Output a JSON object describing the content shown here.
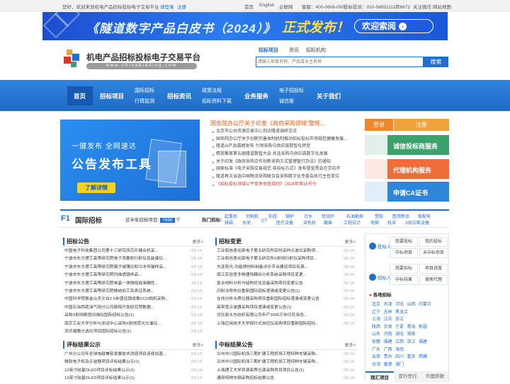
{
  "topbar": {
    "welcome": "您好，欢迎来到机电产品招标投标电子交易平台",
    "login": "请登录",
    "register": "注册",
    "links": [
      "首页",
      "English",
      "必联网"
    ],
    "phone_label": "客服：400-0606-000",
    "phone2_label": "投标投诉：010-58851111转6672",
    "wechat": "关注微信",
    "sitemap": "网站地图"
  },
  "banner": {
    "title": "《隧道数字产品白皮书（2024）》",
    "headline": "正式发布！",
    "button": "欢迎索阅"
  },
  "logo": {
    "name": "机电产品招标投标电子交易平台",
    "url": "www.chinabidding.com"
  },
  "search": {
    "tabs": [
      "招标项目",
      "资讯",
      "招标机构"
    ],
    "placeholder": "请输入项目名称、产品或业主名称",
    "button": "搜索"
  },
  "nav": {
    "home": "首页",
    "projects": "招标项目",
    "intl_bid": "国际招标",
    "credit": "行情监测",
    "news": "招标资讯",
    "policy": "政策法规",
    "docs": "招标资料下载",
    "service": "业务服务",
    "ebid": "电子招投标",
    "honest": "诚信版",
    "about": "关于我们"
  },
  "ad": {
    "line1": "一键发布   全网速达",
    "line2": "公告发布工具",
    "button": "了解详情"
  },
  "news": {
    "headline": "国务院办公厅关于印发《政府采购领域\"整顿...",
    "items": [
      "北京市公共资源交易中心到访隆道调研交流",
      "国务院办公厅关于创新完善体制机制推动招标投标市场规范健康发展...",
      "隆道AI产品震撼发布 引领采购与供应链数智化转型",
      "精英聚首第五届隆道数智大会 共话采购与供应链数字化发展",
      "关于印发《政府采购合作创新采购方式管理暂行办法》的通知",
      "国家标准《电子采购交易规范 非招标方式》发布暨宣贯会在京召开",
      "隆道再次当选中国物流采购联合会采购数字化专委会执行主任单位"
    ],
    "red_item": "《招标投标领域公平竞争审查规则》 2024年第16号令"
  },
  "auth": {
    "login": "登录",
    "register": "注册"
  },
  "services": [
    {
      "label": "诚信投标商服务",
      "color": "#3aa26a"
    },
    {
      "label": "代理机构服务",
      "color": "#ef6d3a"
    },
    {
      "label": "申请CA证书",
      "color": "#2f85da"
    }
  ],
  "f1": {
    "no": "F1",
    "title": "国际招标",
    "count_label": "近半年招标项目:",
    "count": "7696",
    "count_unit": "个",
    "hot_label": "热门招标:",
    "tags_row1": [
      "起重机",
      "切割机",
      "彩超",
      "锅炉",
      "污水",
      "焚烧炉",
      "石油勘探",
      "塑胶",
      "医用新品",
      "锻配电"
    ],
    "tags_row2": [
      "核磁",
      "水泥",
      "CT",
      "医疗设备",
      "染色机",
      "腹珠",
      "工程设计",
      "电梯",
      "机床",
      "X线诊断设备"
    ]
  },
  "bid_notice": {
    "title": "招标公告",
    "more": "更多>",
    "rows": [
      [
        "中国电子科技集团公司第十三研究所芯片键合机采...",
        "09-14"
      ],
      [
        "宁波市东方理工高等研究院电子背散射衍射仪及能谱仪...",
        "09-14"
      ],
      [
        "宁波市东方理工高等研究院离子减薄仪和冷冻传输样品...",
        "09-14"
      ],
      [
        "宁波市东方理工高等研究院扫描透镜样品...",
        "09-14"
      ],
      [
        "宁波市东方理工高等研究院单晶一体微组成准确性...",
        "09-14"
      ],
      [
        "宁波市东方理工高等研究院微纳加工及表征系统...",
        "09-14"
      ],
      [
        "中国科学院紫金山天文台2.5米望远镜成像CCD相机采购...",
        "09-14"
      ],
      [
        "中国石油西南油气田分公司勘探开发研究院数据...",
        "09-14"
      ],
      [
        "采购X射线断层扫描仪国际招标公告(1)",
        "09-14"
      ],
      [
        "南京工业大学分析与测试中心采购X射线荧光光谱仪...",
        "09-14"
      ],
      [
        "流式细胞分选仪项目国际招标公告(1)",
        "09-14"
      ]
    ]
  },
  "bid_change": {
    "title": "招标变更",
    "more": "更多>",
    "rows": [
      [
        "工业和信息化部电子第五研究所实时采样示波仪采购项...",
        "09-14"
      ],
      [
        "工业和信息化部电子第五研究所X射线衍射仪采购项目...",
        "09-14"
      ],
      [
        "大连阳光-功能燃材料制备评价平台建设项目有源...",
        "09-14"
      ],
      [
        "南江实验室多物理场耦合分析系统采购项目变更...",
        "09-14"
      ],
      [
        "复合材料分析与结构优化设备采购项目变更公告",
        "09-14"
      ],
      [
        "闪射法导热仪重新国际招标澄清或变更公告(1)",
        "09-14"
      ],
      [
        "在线分析水质仪器采购项目重新国际招标澄清或变更公告",
        "09-14"
      ],
      [
        "高带宽示波器采购项目澄清或变更公告(1)",
        "09-14"
      ],
      [
        "河北新太东纺织有限公司年产3000万米印花染色...",
        "09-14"
      ],
      [
        "上海应用技术大学探针式自控仪采购项目重新国际招标...",
        "09-14"
      ]
    ]
  },
  "result_notice": {
    "title": "评标结果公示",
    "more": "更多>",
    "rows": [
      [
        "广州分公司年全球电磁兼容发展技术改造项目连续加盖...",
        "09-14"
      ],
      [
        "微软电子机及示波器项目评标结果公示(1)",
        "09-14"
      ],
      [
        "12英寸硅基OLED项目评标结果公示(1)",
        "09-14"
      ],
      [
        "12英寸硅基OLED项目评标结果公示(1)",
        "09-14"
      ]
    ]
  },
  "award_notice": {
    "title": "中标结果公告",
    "more": "更多>",
    "rows": [
      [
        "兰州中川国际机场三期扩建工程机场工程特种车辆采购...",
        "09-14"
      ],
      [
        "兰州中川国际机场三期扩建工程机场工程特种车辆采购...",
        "09-14"
      ],
      [
        "上海理工大学资源高等光源采购项目项目公告(1)",
        "09-14"
      ],
      [
        "通用特种车辆采购招标结果公告",
        "09-14"
      ]
    ]
  },
  "side": {
    "bidder": "投标人",
    "tenderer": "招标人",
    "bidder_links": [
      "我要投标",
      "我的投标",
      "中标项目",
      "未中标项目"
    ],
    "tenderer_links": [
      "我要招标",
      "项目进度",
      "中标结果",
      "搜索代理"
    ],
    "region_title": "各地招标",
    "provinces": [
      [
        "北京",
        "天津",
        "河北",
        "山西",
        "内蒙古"
      ],
      [
        "辽宁",
        "吉林",
        "黑龙江"
      ],
      [
        "上海",
        "江苏",
        "浙江"
      ],
      [
        "陕西",
        "甘肃",
        "宁夏",
        "青海",
        "新疆"
      ],
      [
        "山东",
        "河南",
        "湖北",
        "湖南"
      ],
      [
        "安徽",
        "福建",
        "江西",
        "浙江",
        "福建"
      ],
      [
        "广东",
        "广西",
        "海南"
      ],
      [
        "云南",
        "贵州",
        "四川",
        "重庆",
        "西藏"
      ],
      [
        "台湾",
        "香港",
        "澳门"
      ]
    ],
    "bottom_tabs": [
      "观汇项目",
      "亚行世行",
      "外国贷款"
    ]
  }
}
